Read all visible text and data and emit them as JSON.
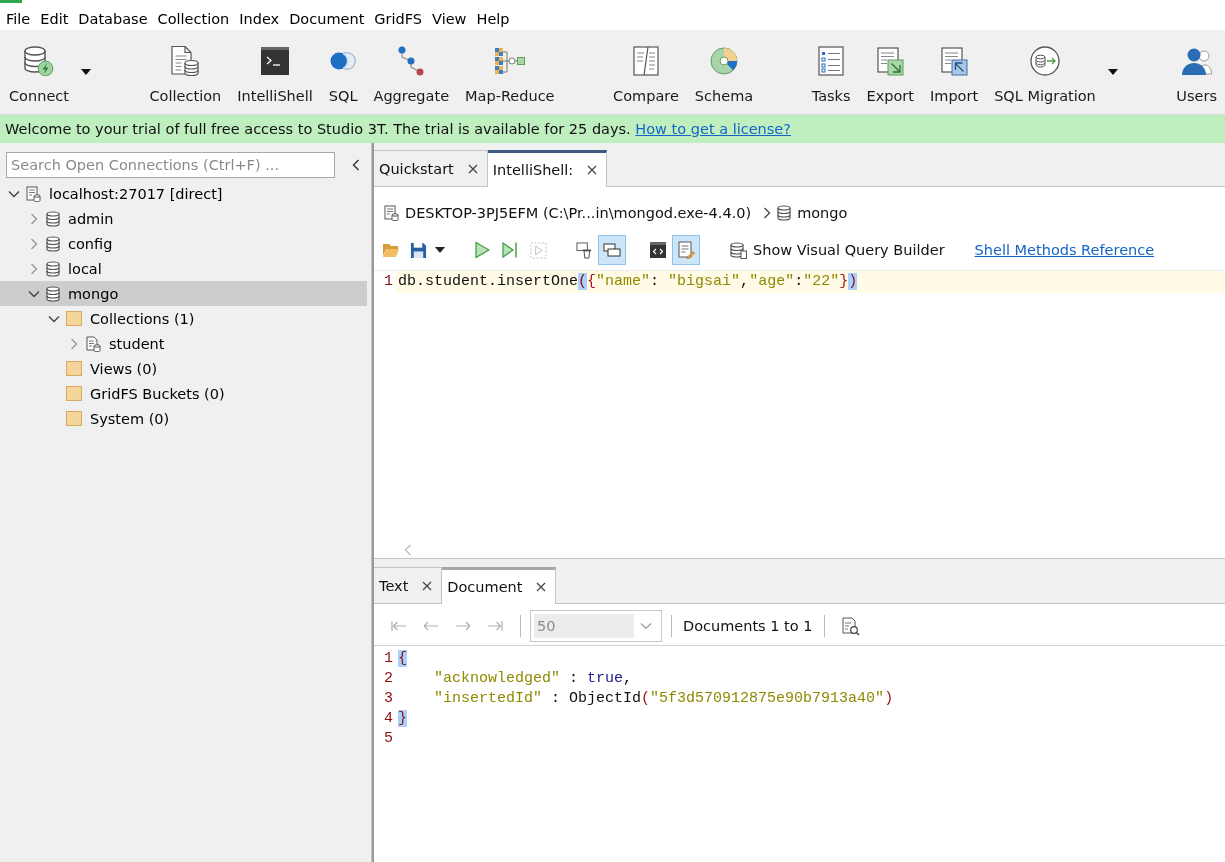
{
  "menu": [
    "File",
    "Edit",
    "Database",
    "Collection",
    "Index",
    "Document",
    "GridFS",
    "View",
    "Help"
  ],
  "toolbar": {
    "groups": [
      [
        {
          "label": "Connect",
          "dropdown": true
        }
      ],
      [
        {
          "label": "Collection",
          "dropdown": false
        },
        {
          "label": "IntelliShell",
          "dropdown": false
        },
        {
          "label": "SQL",
          "dropdown": false
        },
        {
          "label": "Aggregate",
          "dropdown": false
        },
        {
          "label": "Map-Reduce",
          "dropdown": false
        }
      ],
      [
        {
          "label": "Compare",
          "dropdown": false
        },
        {
          "label": "Schema",
          "dropdown": false
        }
      ],
      [
        {
          "label": "Tasks",
          "dropdown": false
        },
        {
          "label": "Export",
          "dropdown": false
        },
        {
          "label": "Import",
          "dropdown": false
        },
        {
          "label": "SQL Migration",
          "dropdown": true
        }
      ],
      [
        {
          "label": "Users",
          "dropdown": false
        }
      ]
    ]
  },
  "banner": {
    "message": "Welcome to your trial of full free access to Studio 3T. The trial is available for 25 days.",
    "link": "How to get a license?"
  },
  "sidebar": {
    "search": {
      "placeholder": "Search Open Connections (Ctrl+F) ..."
    },
    "tree": [
      {
        "label": "localhost:27017 [direct]",
        "kind": "server",
        "expanded": true,
        "selected": false,
        "children": [
          {
            "label": "admin",
            "kind": "database",
            "expanded": false,
            "selected": false
          },
          {
            "label": "config",
            "kind": "database",
            "expanded": false,
            "selected": false
          },
          {
            "label": "local",
            "kind": "database",
            "expanded": false,
            "selected": false
          },
          {
            "label": "mongo",
            "kind": "database",
            "expanded": true,
            "selected": true,
            "children": [
              {
                "label": "Collections (1)",
                "kind": "folder",
                "expanded": true,
                "selected": false,
                "children": [
                  {
                    "label": "student",
                    "kind": "collection",
                    "expanded": false,
                    "selected": false
                  }
                ]
              },
              {
                "label": "Views (0)",
                "kind": "folder",
                "selected": false
              },
              {
                "label": "GridFS Buckets (0)",
                "kind": "folder",
                "selected": false
              },
              {
                "label": "System (0)",
                "kind": "folder",
                "selected": false
              }
            ]
          }
        ]
      }
    ]
  },
  "editor_tabs": [
    {
      "label": "Quickstart",
      "selected": false
    },
    {
      "label": "IntelliShell:",
      "selected": true
    }
  ],
  "breadcrumb": {
    "connection": "DESKTOP-3PJ5EFM (C:\\Pr...in\\mongod.exe-4.4.0)",
    "database": "mongo"
  },
  "shell_toolbar": {
    "groups": [
      [
        {
          "pressed": false,
          "disabled": false,
          "dropdown": false
        },
        {
          "pressed": false,
          "disabled": false,
          "dropdown": true
        }
      ],
      [
        {
          "pressed": false,
          "disabled": false,
          "dropdown": false
        },
        {
          "pressed": false,
          "disabled": false,
          "dropdown": false
        },
        {
          "pressed": false,
          "disabled": true,
          "dropdown": false
        }
      ],
      [
        {
          "pressed": false,
          "disabled": false,
          "dropdown": false
        },
        {
          "pressed": true,
          "disabled": false,
          "dropdown": false
        }
      ],
      [
        {
          "pressed": false,
          "disabled": false,
          "dropdown": false
        },
        {
          "pressed": true,
          "disabled": false,
          "dropdown": false
        }
      ]
    ],
    "query_builder": "Show Visual Query Builder",
    "reference_link": "Shell Methods Reference"
  },
  "editor": {
    "lines": [
      {
        "number": "1",
        "current": true,
        "tokens": [
          {
            "text": "db.student.insertOne",
            "kind": "plain"
          },
          {
            "text": "(",
            "kind": "match"
          },
          {
            "text": "{",
            "kind": "brace"
          },
          {
            "text": "\"name\"",
            "kind": "string"
          },
          {
            "text": ": ",
            "kind": "plain"
          },
          {
            "text": "\"bigsai\"",
            "kind": "string"
          },
          {
            "text": ",",
            "kind": "plain"
          },
          {
            "text": "\"age\"",
            "kind": "string"
          },
          {
            "text": ":",
            "kind": "plain"
          },
          {
            "text": "\"22\"",
            "kind": "string"
          },
          {
            "text": "}",
            "kind": "brace"
          },
          {
            "text": ")",
            "kind": "match"
          }
        ]
      }
    ]
  },
  "result_tabs": [
    {
      "label": "Text",
      "selected": false
    },
    {
      "label": "Document",
      "selected": true
    }
  ],
  "result_toolbar": {
    "navigation": [
      {
        "disabled": true
      },
      {
        "disabled": true
      },
      {
        "disabled": true
      },
      {
        "disabled": true
      }
    ],
    "page_size": {
      "value": "50",
      "disabled": true
    },
    "range": "Documents 1 to 1"
  },
  "result": {
    "lines": [
      {
        "number": "1",
        "tokens": [
          {
            "text": "{",
            "kind": "match"
          }
        ]
      },
      {
        "number": "2",
        "tokens": [
          {
            "text": "    \"acknowledged\"",
            "kind": "string"
          },
          {
            "text": " : ",
            "kind": "plain"
          },
          {
            "text": "true",
            "kind": "keyword"
          },
          {
            "text": ",",
            "kind": "plain"
          }
        ]
      },
      {
        "number": "3",
        "tokens": [
          {
            "text": "    \"insertedId\"",
            "kind": "string"
          },
          {
            "text": " : ObjectId",
            "kind": "plain"
          },
          {
            "text": "(",
            "kind": "brace"
          },
          {
            "text": "\"5f3d570912875e90b7913a40\"",
            "kind": "string"
          },
          {
            "text": ")",
            "kind": "brace"
          }
        ]
      },
      {
        "number": "4",
        "tokens": [
          {
            "text": "}",
            "kind": "match"
          }
        ]
      },
      {
        "number": "5"
      }
    ]
  }
}
